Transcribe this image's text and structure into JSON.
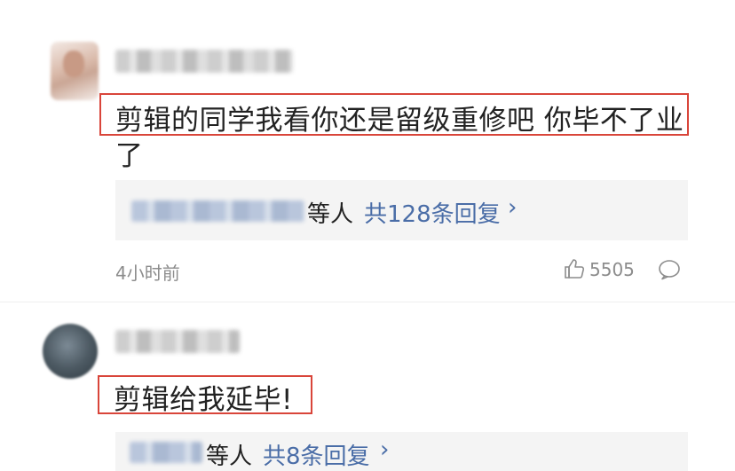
{
  "comment_1": {
    "username_hidden": "",
    "text_line1": "剪辑的同学我看你还是留级重修吧 你毕不了业",
    "text_line2": "了",
    "replies": {
      "people_label": "等人",
      "count_label": "共128条回复",
      "chevron": "›"
    },
    "timestamp": "4小时前",
    "like_count": "5505"
  },
  "comment_2": {
    "username_hidden": "",
    "text": "剪辑给我延毕!",
    "replies": {
      "people_label": "等人",
      "count_label": "共8条回复",
      "chevron": "›"
    }
  },
  "colors": {
    "highlight_border": "#d9453a",
    "link_blue": "#4a6da7",
    "meta_gray": "#8c8c8c",
    "reply_bg": "#f4f4f4"
  },
  "icons": [
    "thumbs-up-icon",
    "comment-bubble-icon",
    "chevron-right-icon"
  ]
}
